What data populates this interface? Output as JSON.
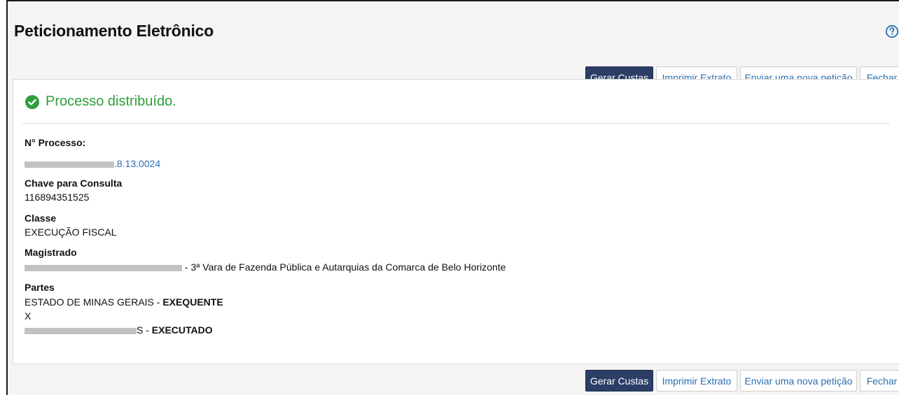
{
  "page": {
    "title": "Peticionamento Eletrônico"
  },
  "icons": {
    "help": "help-icon",
    "status": "check-circle-icon"
  },
  "toolbar": {
    "gerar_custas": "Gerar Custas",
    "imprimir_extrato": "Imprimir Extrato",
    "enviar_nova": "Enviar uma nova petição",
    "fechar": "Fechar"
  },
  "status": {
    "message": "Processo distribuído."
  },
  "fields": {
    "numero_label": "N° Processo:",
    "numero_suffix": ".8.13.0024",
    "chave_label": "Chave para Consulta",
    "chave_value": "116894351525",
    "classe_label": "Classe",
    "classe_value": "EXECUÇÃO FISCAL",
    "magistrado_label": "Magistrado",
    "magistrado_suffix": " - 3ª Vara de Fazenda Pública e Autarquias da Comarca de Belo Horizonte",
    "partes_label": "Partes",
    "parte1_name": "ESTADO DE MINAS GERAIS - ",
    "parte1_role": "EXEQUENTE",
    "versus": "X",
    "parte2_prefix": "S - ",
    "parte2_role": "EXECUTADO"
  },
  "colors": {
    "primary_button": "#2c3e66",
    "link": "#2a6fb0",
    "success": "#2e9e3c"
  }
}
